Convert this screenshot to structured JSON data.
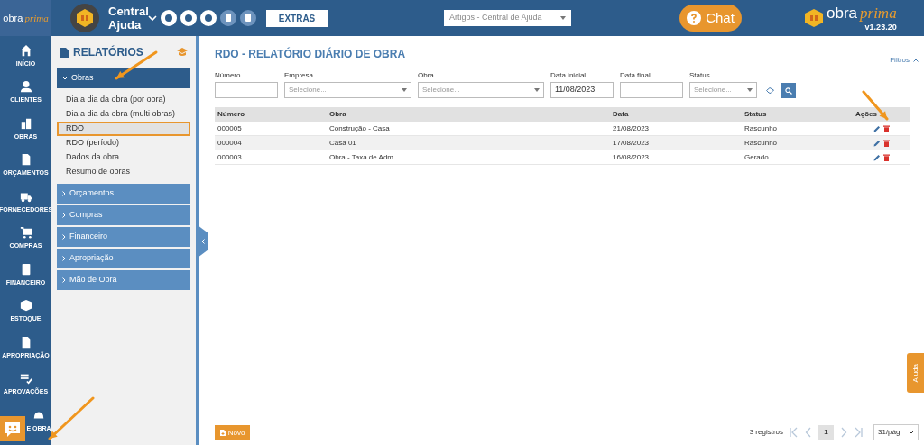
{
  "topbar": {
    "logo": {
      "word1": "obra",
      "word2": "prima"
    },
    "help_center": "Central Ajuda",
    "extras_button": "EXTRAS",
    "article_select": "Artigos - Central de Ajuda",
    "chat_button": "Chat",
    "brand": {
      "word1": "obra",
      "word2": "prima"
    },
    "version": "v1.23.20"
  },
  "nav": [
    {
      "label": "INÍCIO"
    },
    {
      "label": "CLIENTES"
    },
    {
      "label": "OBRAS"
    },
    {
      "label": "ORÇAMENTOS"
    },
    {
      "label": "FORNECEDORES"
    },
    {
      "label": "COMPRAS"
    },
    {
      "label": "FINANCEIRO"
    },
    {
      "label": "ESTOQUE"
    },
    {
      "label": "APROPRIAÇÃO"
    },
    {
      "label": "APROVAÇÕES"
    },
    {
      "label": "E OBRA"
    }
  ],
  "reports": {
    "title": "RELATÓRIOS",
    "sections": [
      {
        "label": "Obras",
        "expanded": true,
        "items": [
          {
            "label": "Dia a dia da obra (por obra)",
            "selected": false,
            "highlighted": false
          },
          {
            "label": "Dia a dia da obra (multi obras)",
            "selected": false,
            "highlighted": false
          },
          {
            "label": "RDO",
            "selected": true,
            "highlighted": true
          },
          {
            "label": "RDO (período)",
            "selected": false,
            "highlighted": false
          },
          {
            "label": "Dados da obra",
            "selected": false,
            "highlighted": false
          },
          {
            "label": "Resumo de obras",
            "selected": false,
            "highlighted": false
          }
        ]
      },
      {
        "label": "Orçamentos",
        "expanded": false
      },
      {
        "label": "Compras",
        "expanded": false
      },
      {
        "label": "Financeiro",
        "expanded": false
      },
      {
        "label": "Apropriação",
        "expanded": false
      },
      {
        "label": "Mão de Obra",
        "expanded": false
      }
    ]
  },
  "page": {
    "title": "RDO - RELATÓRIO DIÁRIO DE OBRA",
    "filters_toggle": "Filtros",
    "filters": [
      {
        "label": "Número",
        "kind": "text"
      },
      {
        "label": "Empresa",
        "kind": "select",
        "placeholder": "Selecione..."
      },
      {
        "label": "Obra",
        "kind": "select",
        "placeholder": "Selecione..."
      },
      {
        "label": "Data inicial",
        "kind": "text",
        "value": "11/08/2023"
      },
      {
        "label": "Data final",
        "kind": "text"
      },
      {
        "label": "Status",
        "kind": "select",
        "placeholder": "Selecione..."
      }
    ],
    "table": {
      "columns": [
        "Número",
        "Obra",
        "Data",
        "Status",
        "Ações"
      ],
      "rows": [
        {
          "cells": [
            "000005",
            "Construção - Casa",
            "21/08/2023",
            "Rascunho"
          ]
        },
        {
          "cells": [
            "000004",
            "Casa 01",
            "17/08/2023",
            "Rascunho"
          ]
        },
        {
          "cells": [
            "000003",
            "Obra - Taxa de Adm",
            "16/08/2023",
            "Gerado"
          ]
        }
      ]
    },
    "new_button": "Novo",
    "record_count": "3 registros",
    "current_page": "1",
    "page_size": "31/pág."
  },
  "help_tab": "Ajuda"
}
